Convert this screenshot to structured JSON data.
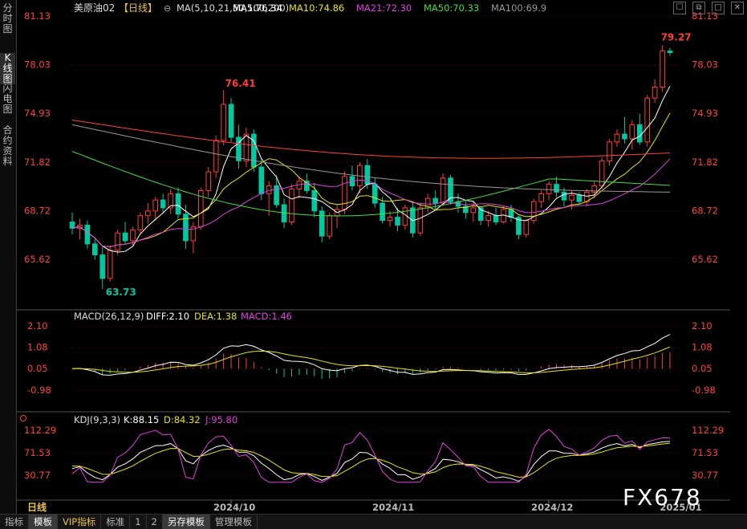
{
  "side_tabs": [
    {
      "label": "分\n时\n图",
      "active": false
    },
    {
      "label": "K\n线\n图",
      "active": true
    },
    {
      "label": "闪\n电\n图",
      "active": false
    },
    {
      "label": "合\n约\n资\n料",
      "active": false
    }
  ],
  "price_panel": {
    "symbol": "美原油02",
    "period": "【日线】",
    "ma_label": "MA(5,10,21,50,100,200)",
    "ma_values": [
      {
        "text": "MA5:76.34",
        "color": "#ffffff"
      },
      {
        "text": "MA10:74.86",
        "color": "#e6e600"
      },
      {
        "text": "MA21:72.30",
        "color": "#e040e0"
      },
      {
        "text": "MA50:70.33",
        "color": "#44dd44"
      },
      {
        "text": "MA100:69.9",
        "color": "#999999"
      }
    ],
    "y_ticks": [
      "81.13",
      "78.03",
      "74.93",
      "71.82",
      "68.72",
      "65.62"
    ],
    "annotations": {
      "high_1": "76.41",
      "low_1": "63.73",
      "high_2": "79.27"
    }
  },
  "macd_panel": {
    "label": "MACD(26,12,9)",
    "diff": "DIFF:2.10",
    "dea": "DEA:1.38",
    "macd": "MACD:1.46",
    "y_ticks": [
      "2.10",
      "1.08",
      "0.05",
      "-0.98"
    ]
  },
  "kdj_panel": {
    "label": "KDJ(9,3,3)",
    "k": "K:88.15",
    "d": "D:84.32",
    "j": "J:95.80",
    "y_ticks": [
      "112.29",
      "71.53",
      "30.77"
    ]
  },
  "x_axis": {
    "period_label": "日线",
    "dates": [
      "2024/10",
      "2024/11",
      "2024/12",
      "2025/01"
    ]
  },
  "bottom_tabs": [
    {
      "label": "指标",
      "active": false,
      "vip": false
    },
    {
      "label": "模板",
      "active": true,
      "vip": false
    },
    {
      "label": "VIP指标",
      "active": false,
      "vip": true
    },
    {
      "label": "标准",
      "active": false,
      "vip": false
    },
    {
      "label": "1",
      "active": false,
      "vip": false
    },
    {
      "label": "2",
      "active": false,
      "vip": false
    },
    {
      "label": "另存模板",
      "active": true,
      "vip": false
    },
    {
      "label": "管理模板",
      "active": false,
      "vip": false
    }
  ],
  "window_buttons": [
    {
      "name": "pin",
      "glyph": "☐"
    },
    {
      "name": "copy",
      "glyph": "⧉"
    },
    {
      "name": "maximize",
      "glyph": "□"
    },
    {
      "name": "close",
      "glyph": "✕"
    }
  ],
  "watermark": "FX678",
  "colors": {
    "up": "#ff3c3c",
    "down": "#00c8a0",
    "grid": "#5a0000",
    "axis_text": "#ff4040"
  },
  "chart_data": {
    "type": "candlestick",
    "x_dates": [
      "2024/10",
      "2024/11",
      "2024/12",
      "2025/01"
    ],
    "ylim": [
      64.0,
      81.5
    ],
    "ohlc": [
      [
        68.0,
        68.6,
        67.2,
        67.6
      ],
      [
        67.6,
        68.2,
        66.9,
        67.8
      ],
      [
        67.8,
        68.1,
        66.3,
        66.6
      ],
      [
        66.6,
        66.9,
        65.6,
        65.9
      ],
      [
        65.9,
        66.4,
        63.73,
        64.4
      ],
      [
        64.4,
        66.5,
        64.2,
        66.2
      ],
      [
        66.2,
        67.5,
        65.9,
        67.3
      ],
      [
        67.3,
        68.0,
        66.6,
        66.8
      ],
      [
        66.8,
        67.7,
        66.5,
        67.5
      ],
      [
        67.5,
        68.6,
        67.2,
        68.4
      ],
      [
        68.4,
        69.2,
        67.9,
        68.7
      ],
      [
        68.7,
        69.6,
        68.1,
        69.4
      ],
      [
        69.4,
        69.8,
        68.6,
        68.9
      ],
      [
        68.9,
        70.1,
        68.5,
        69.8
      ],
      [
        69.8,
        70.2,
        68.2,
        68.5
      ],
      [
        68.5,
        69.1,
        66.3,
        66.8
      ],
      [
        66.8,
        68.0,
        66.0,
        67.7
      ],
      [
        67.7,
        70.2,
        67.5,
        70.0
      ],
      [
        70.0,
        71.5,
        69.6,
        71.2
      ],
      [
        71.2,
        73.5,
        70.8,
        73.2
      ],
      [
        73.2,
        76.41,
        72.9,
        75.5
      ],
      [
        75.5,
        75.9,
        73.1,
        73.4
      ],
      [
        73.4,
        74.2,
        71.4,
        71.9
      ],
      [
        71.9,
        74.0,
        71.5,
        73.6
      ],
      [
        73.6,
        73.9,
        71.2,
        71.5
      ],
      [
        71.5,
        72.0,
        69.4,
        69.8
      ],
      [
        69.8,
        70.6,
        68.4,
        70.3
      ],
      [
        70.3,
        71.0,
        68.9,
        69.1
      ],
      [
        69.1,
        69.5,
        67.6,
        68.0
      ],
      [
        68.0,
        70.4,
        67.8,
        70.1
      ],
      [
        70.1,
        70.9,
        69.5,
        70.6
      ],
      [
        70.6,
        71.1,
        69.8,
        70.0
      ],
      [
        70.0,
        70.5,
        68.3,
        68.7
      ],
      [
        68.7,
        69.0,
        66.7,
        67.1
      ],
      [
        67.1,
        68.6,
        66.9,
        68.4
      ],
      [
        68.4,
        69.1,
        67.6,
        68.8
      ],
      [
        68.8,
        71.2,
        68.5,
        70.9
      ],
      [
        70.9,
        71.6,
        70.0,
        70.3
      ],
      [
        70.3,
        71.8,
        69.8,
        71.6
      ],
      [
        71.6,
        72.0,
        70.1,
        70.4
      ],
      [
        70.4,
        70.8,
        68.9,
        69.2
      ],
      [
        69.2,
        69.6,
        67.9,
        68.1
      ],
      [
        68.1,
        68.7,
        67.7,
        68.3
      ],
      [
        68.3,
        68.9,
        67.4,
        67.8
      ],
      [
        67.8,
        69.1,
        67.5,
        68.9
      ],
      [
        68.9,
        69.3,
        67.0,
        67.3
      ],
      [
        67.3,
        69.2,
        67.1,
        68.9
      ],
      [
        68.9,
        69.8,
        68.6,
        69.5
      ],
      [
        69.5,
        70.0,
        68.8,
        69.2
      ],
      [
        69.2,
        71.1,
        69.0,
        70.8
      ],
      [
        70.8,
        71.0,
        69.1,
        69.3
      ],
      [
        69.3,
        69.8,
        68.6,
        69.0
      ],
      [
        69.0,
        69.4,
        68.2,
        68.6
      ],
      [
        68.6,
        69.3,
        68.0,
        68.9
      ],
      [
        68.9,
        69.0,
        67.8,
        68.1
      ],
      [
        68.1,
        68.7,
        67.7,
        68.4
      ],
      [
        68.4,
        68.9,
        67.8,
        68.0
      ],
      [
        68.0,
        69.0,
        67.9,
        68.8
      ],
      [
        68.8,
        69.1,
        68.0,
        68.3
      ],
      [
        68.3,
        68.4,
        66.9,
        67.2
      ],
      [
        67.2,
        68.2,
        67.0,
        68.1
      ],
      [
        68.1,
        69.5,
        67.9,
        69.3
      ],
      [
        69.3,
        70.0,
        68.9,
        69.8
      ],
      [
        69.8,
        70.6,
        69.4,
        70.4
      ],
      [
        70.4,
        70.9,
        69.6,
        69.9
      ],
      [
        69.9,
        70.2,
        69.0,
        69.4
      ],
      [
        69.4,
        70.0,
        68.8,
        69.7
      ],
      [
        69.7,
        69.9,
        69.1,
        69.3
      ],
      [
        69.3,
        70.1,
        69.0,
        69.9
      ],
      [
        69.9,
        70.6,
        69.5,
        70.3
      ],
      [
        70.3,
        72.1,
        70.1,
        71.9
      ],
      [
        71.9,
        73.3,
        71.6,
        73.1
      ],
      [
        73.1,
        73.9,
        72.8,
        73.6
      ],
      [
        73.6,
        74.7,
        73.0,
        73.3
      ],
      [
        73.3,
        74.5,
        72.6,
        74.2
      ],
      [
        74.2,
        74.9,
        72.9,
        73.1
      ],
      [
        73.1,
        76.1,
        72.8,
        75.9
      ],
      [
        75.9,
        77.1,
        75.6,
        76.6
      ],
      [
        76.6,
        79.27,
        76.3,
        78.9
      ],
      [
        78.9,
        79.1,
        78.6,
        78.8
      ]
    ],
    "series": [
      {
        "name": "MA5",
        "color": "#ffffff",
        "last": 76.34
      },
      {
        "name": "MA10",
        "color": "#e6e600",
        "last": 74.86
      },
      {
        "name": "MA21",
        "color": "#e040e0",
        "last": 72.3
      },
      {
        "name": "MA50",
        "color": "#44dd44",
        "last": 70.33
      },
      {
        "name": "MA100",
        "color": "#999999",
        "last": 69.9
      },
      {
        "name": "MA200",
        "color": "#ff4040",
        "last": 72.4
      }
    ]
  }
}
